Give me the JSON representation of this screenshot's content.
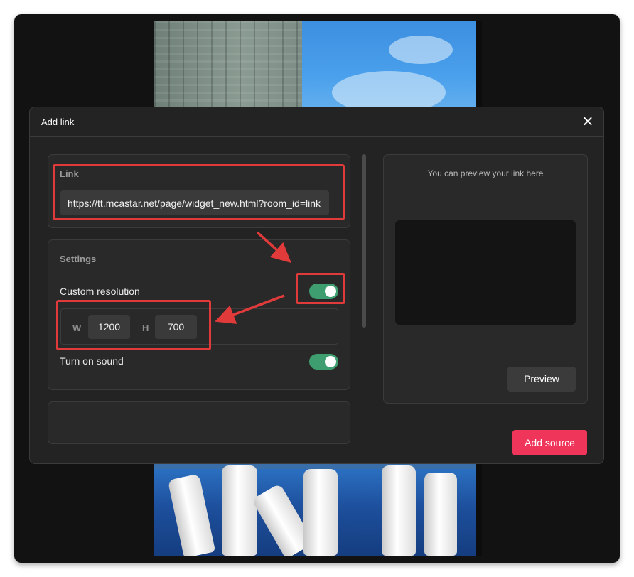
{
  "dialog": {
    "title": "Add link",
    "link": {
      "label": "Link",
      "value": "https://tt.mcastar.net/page/widget_new.html?room_id=link"
    },
    "settings": {
      "label": "Settings",
      "custom_resolution_label": "Custom resolution",
      "custom_resolution_on": true,
      "width_label": "W",
      "width_value": "1200",
      "height_label": "H",
      "height_value": "700",
      "sound_label": "Turn on sound",
      "sound_on": true
    },
    "preview": {
      "hint": "You can preview your link here",
      "button_label": "Preview"
    },
    "add_source_label": "Add source"
  },
  "colors": {
    "accent": "#f0355a",
    "toggle_on": "#3f9e6f",
    "annotation": "#e03a3a"
  }
}
